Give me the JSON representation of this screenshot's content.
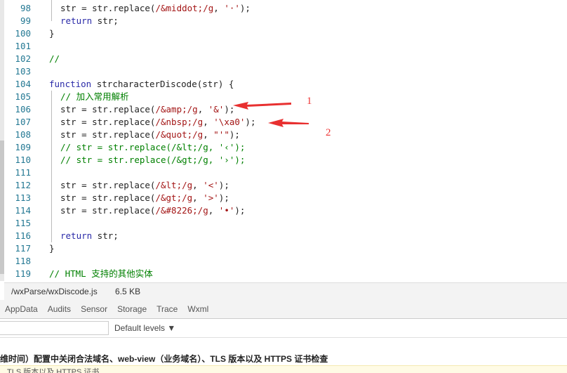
{
  "editor": {
    "lines": [
      {
        "n": "98",
        "indent": 1,
        "tokens": [
          [
            "",
            "str = str.replace("
          ],
          [
            "re",
            "/&middot;/g"
          ],
          [
            "",
            ", "
          ],
          [
            "st",
            "'·'"
          ],
          [
            "",
            ");"
          ]
        ]
      },
      {
        "n": "99",
        "indent": 1,
        "tokens": [
          [
            "kw",
            "return"
          ],
          [
            "",
            " str;"
          ]
        ]
      },
      {
        "n": "100",
        "indent": 0,
        "tokens": [
          [
            "",
            "}"
          ]
        ]
      },
      {
        "n": "101",
        "indent": 0,
        "tokens": []
      },
      {
        "n": "102",
        "indent": 0,
        "tokens": [
          [
            "cm",
            "//"
          ]
        ]
      },
      {
        "n": "103",
        "indent": 0,
        "tokens": []
      },
      {
        "n": "104",
        "indent": 0,
        "tokens": [
          [
            "kw",
            "function"
          ],
          [
            "",
            " strcharacterDiscode(str) {"
          ]
        ]
      },
      {
        "n": "105",
        "indent": 1,
        "tokens": [
          [
            "cm",
            "// 加入常用解析"
          ]
        ]
      },
      {
        "n": "106",
        "indent": 1,
        "tokens": [
          [
            "",
            "str = str.replace("
          ],
          [
            "re",
            "/&amp;/g"
          ],
          [
            "",
            ", "
          ],
          [
            "st",
            "'&'"
          ],
          [
            "",
            ");"
          ]
        ]
      },
      {
        "n": "107",
        "indent": 1,
        "tokens": [
          [
            "",
            "str = str.replace("
          ],
          [
            "re",
            "/&nbsp;/g"
          ],
          [
            "",
            ", "
          ],
          [
            "st",
            "'\\xa0'"
          ],
          [
            "",
            ");"
          ]
        ]
      },
      {
        "n": "108",
        "indent": 1,
        "tokens": [
          [
            "",
            "str = str.replace("
          ],
          [
            "re",
            "/&quot;/g"
          ],
          [
            "",
            ", "
          ],
          [
            "st",
            "\"'\""
          ],
          [
            "",
            ");"
          ]
        ]
      },
      {
        "n": "109",
        "indent": 1,
        "tokens": [
          [
            "cm",
            "// str = str.replace(/&lt;/g, '‹');"
          ]
        ]
      },
      {
        "n": "110",
        "indent": 1,
        "tokens": [
          [
            "cm",
            "// str = str.replace(/&gt;/g, '›');"
          ]
        ]
      },
      {
        "n": "111",
        "indent": 1,
        "tokens": []
      },
      {
        "n": "112",
        "indent": 1,
        "tokens": [
          [
            "",
            "str = str.replace("
          ],
          [
            "re",
            "/&lt;/g"
          ],
          [
            "",
            ", "
          ],
          [
            "st",
            "'<'"
          ],
          [
            "",
            ");"
          ]
        ]
      },
      {
        "n": "113",
        "indent": 1,
        "tokens": [
          [
            "",
            "str = str.replace("
          ],
          [
            "re",
            "/&gt;/g"
          ],
          [
            "",
            ", "
          ],
          [
            "st",
            "'>'"
          ],
          [
            "",
            ");"
          ]
        ]
      },
      {
        "n": "114",
        "indent": 1,
        "tokens": [
          [
            "",
            "str = str.replace("
          ],
          [
            "re",
            "/&#8226;/g"
          ],
          [
            "",
            ", "
          ],
          [
            "st",
            "'•'"
          ],
          [
            "",
            ");"
          ]
        ]
      },
      {
        "n": "115",
        "indent": 1,
        "tokens": []
      },
      {
        "n": "116",
        "indent": 1,
        "tokens": [
          [
            "kw",
            "return"
          ],
          [
            "",
            " str;"
          ]
        ]
      },
      {
        "n": "117",
        "indent": 0,
        "tokens": [
          [
            "",
            "}"
          ]
        ]
      },
      {
        "n": "118",
        "indent": 0,
        "tokens": []
      },
      {
        "n": "119",
        "indent": 0,
        "tokens": [
          [
            "cm",
            "// HTML 支持的其他实体"
          ]
        ]
      }
    ]
  },
  "annotations": {
    "label1": "1",
    "label2": "2",
    "color": "#e83030"
  },
  "status": {
    "path": "/wxParse/wxDiscode.js",
    "size": "6.5 KB"
  },
  "tabs": [
    "AppData",
    "Audits",
    "Sensor",
    "Storage",
    "Trace",
    "Wxml"
  ],
  "filter": {
    "levels": "Default levels ▼"
  },
  "console": {
    "message": "维时间）配置中关闭合法域名、web-view（业务域名）、TLS 版本以及 HTTPS 证书检查",
    "warning": "TLS 版本以及 HTTPS 证书"
  }
}
